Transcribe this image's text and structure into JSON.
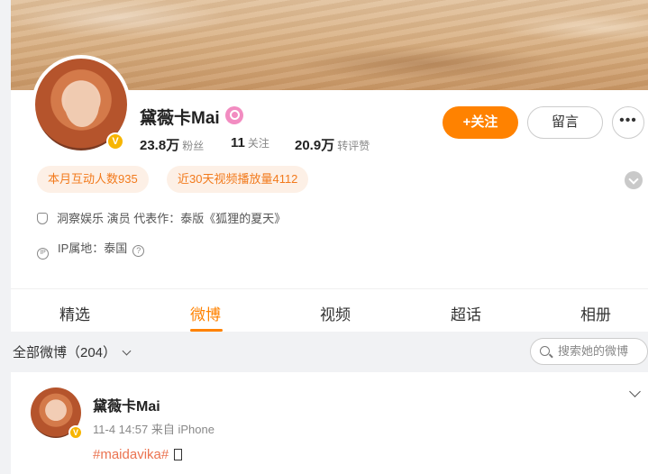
{
  "profile": {
    "name": "黛薇卡Mai",
    "verified_badge": "V",
    "stats": [
      {
        "value": "23.8万",
        "label": "粉丝"
      },
      {
        "value": "11",
        "label": "关注"
      },
      {
        "value": "20.9万",
        "label": "转评赞"
      }
    ],
    "follow_label": "+关注",
    "message_label": "留言",
    "more_label": "•••",
    "pills": [
      "本月互动人数935",
      "近30天视频播放量4112"
    ],
    "info": "洞察娱乐 演员 代表作：泰版《狐狸的夏天》",
    "ip": "IP属地：泰国",
    "ip_icon_text": "IP",
    "help_icon": "?"
  },
  "tabs": [
    {
      "label": "精选",
      "active": false
    },
    {
      "label": "微博",
      "active": true
    },
    {
      "label": "视频",
      "active": false
    },
    {
      "label": "超话",
      "active": false
    },
    {
      "label": "相册",
      "active": false
    }
  ],
  "feed": {
    "filter_label": "全部微博（204）",
    "search_placeholder": "搜索她的微博"
  },
  "post": {
    "author": "黛薇卡Mai",
    "time": "11-4 14:57",
    "source": "来自 iPhone",
    "hashtag": "#maidavika#"
  },
  "colors": {
    "accent": "#ff8200",
    "badge": "#f7b500",
    "pill_bg": "#fdf0e6",
    "pill_text": "#f27a1c",
    "hashtag": "#eb7350"
  }
}
